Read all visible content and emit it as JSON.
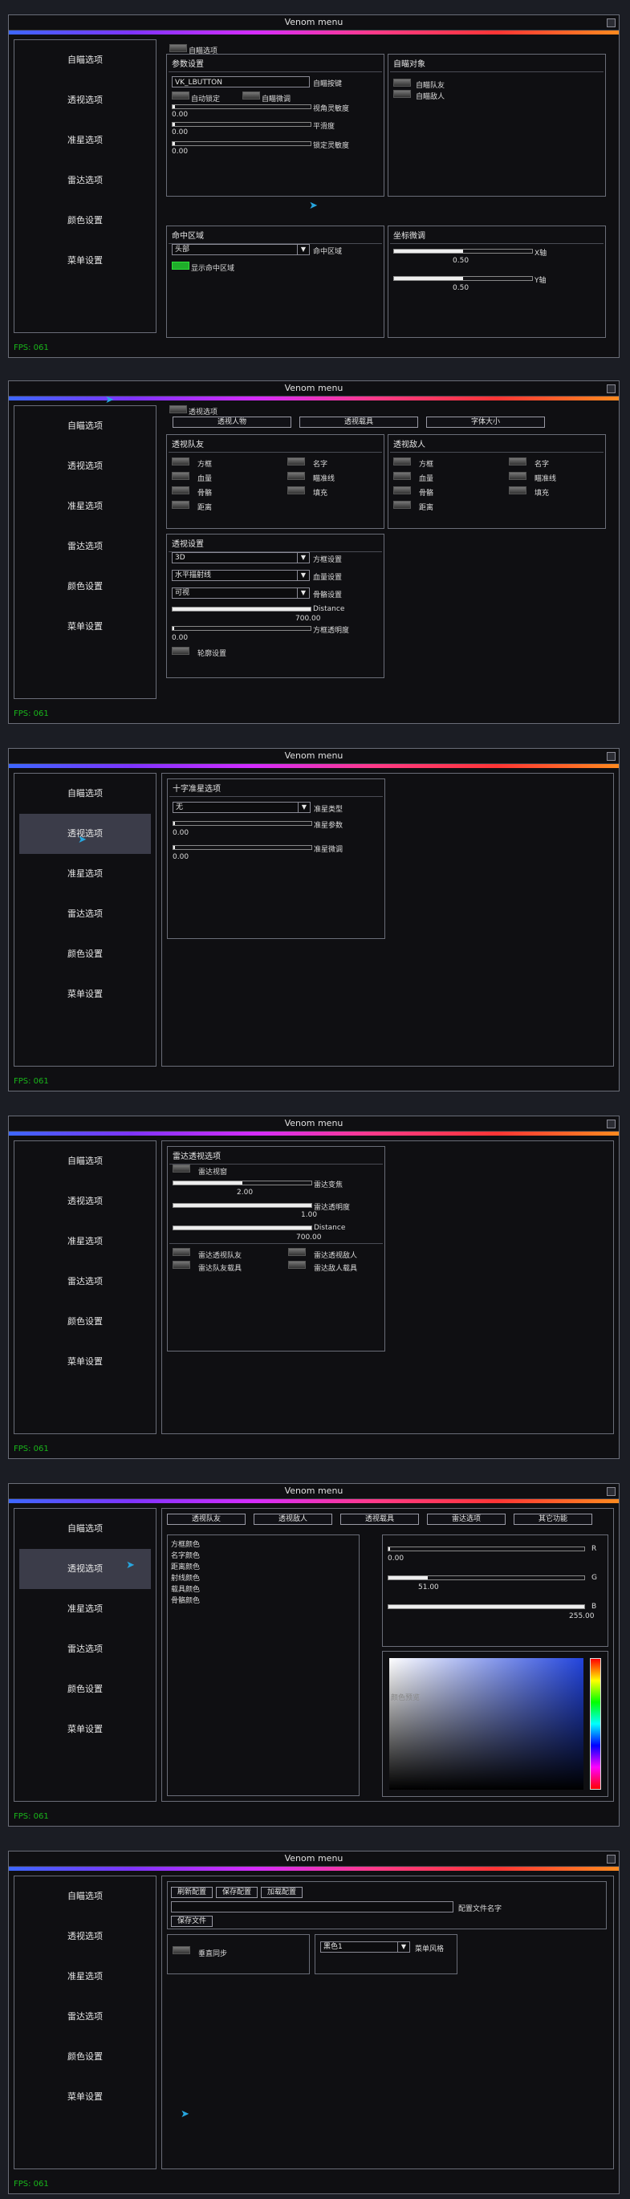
{
  "title": "Venom menu",
  "fps": "FPS: 061",
  "sidebar": [
    "自瞄选项",
    "透视选项",
    "准星选项",
    "雷达选项",
    "颜色设置",
    "菜单设置"
  ],
  "p1": {
    "aim_tab": "自瞄选项",
    "params_title": "参数设置",
    "key_value": "VK_LBUTTON",
    "key_label": "自瞄按键",
    "auto_lock": "自动锁定",
    "auto_fine": "自瞄微调",
    "fov_label": "视角灵敏度",
    "fov_val": "0.00",
    "smooth_label": "平滑度",
    "smooth_val": "0.00",
    "lock_label": "锁定灵敏度",
    "lock_val": "0.00",
    "target_title": "自瞄对象",
    "aim_team": "自瞄队友",
    "aim_enemy": "自瞄敌人",
    "hit_title": "命中区域",
    "hit_value": "头部",
    "hit_label": "命中区域",
    "show_hit": "显示命中区域",
    "coord_title": "坐标微调",
    "x_label": "X轴",
    "x_val": "0.50",
    "y_label": "Y轴",
    "y_val": "0.50"
  },
  "p2": {
    "esp_tab": "透视选项",
    "btn_people": "透视人物",
    "btn_vehicle": "透视载具",
    "btn_font": "字体大小",
    "team_title": "透视队友",
    "enemy_title": "透视敌人",
    "opts": [
      "方框",
      "名字",
      "血量",
      "瞄准线",
      "骨骼",
      "填充",
      "距离"
    ],
    "settings_title": "透视设置",
    "box_value": "3D",
    "box_label": "方框设置",
    "hp_value": "水平描射线",
    "hp_label": "血量设置",
    "bone_value": "可视",
    "bone_label": "骨骼设置",
    "dist_label": "Distance",
    "dist_val": "700.00",
    "alpha_label": "方框透明度",
    "alpha_val": "0.00",
    "outline_label": "轮廓设置"
  },
  "p3": {
    "title": "十字准星选项",
    "type_value": "无",
    "type_label": "准星类型",
    "param_label": "准星参数",
    "param_val": "0.00",
    "fine_label": "准星微调",
    "fine_val": "0.00"
  },
  "p4": {
    "title": "雷达透视选项",
    "radar_view": "雷达视窗",
    "zoom_label": "雷达变焦",
    "zoom_val": "2.00",
    "alpha_label": "雷达透明度",
    "alpha_val": "1.00",
    "dist_label": "Distance",
    "dist_val": "700.00",
    "team": "雷达透视队友",
    "enemy": "雷达透视敌人",
    "team_vehicle": "雷达队友载具",
    "enemy_vehicle": "雷达敌人载具"
  },
  "p5": {
    "tabs": [
      "透视队友",
      "透视敌人",
      "透视载具",
      "雷达选项",
      "其它功能"
    ],
    "colors": [
      "方框颜色",
      "名字颜色",
      "距离颜色",
      "射线颜色",
      "载具颜色",
      "骨骼颜色"
    ],
    "r_label": "R",
    "r_val": "0.00",
    "g_label": "G",
    "g_val": "51.00",
    "b_label": "B",
    "b_val": "255.00",
    "preview": "颜色预览"
  },
  "p6": {
    "refresh": "刷新配置",
    "save": "保存配置",
    "load": "加载配置",
    "name_label": "配置文件名字",
    "save_file": "保存文件",
    "vsync": "垂直同步",
    "style_value": "黑色1",
    "style_label": "菜单风格"
  },
  "colors": {
    "accent_green": "#19b61a",
    "bg": "#0f0f12"
  }
}
